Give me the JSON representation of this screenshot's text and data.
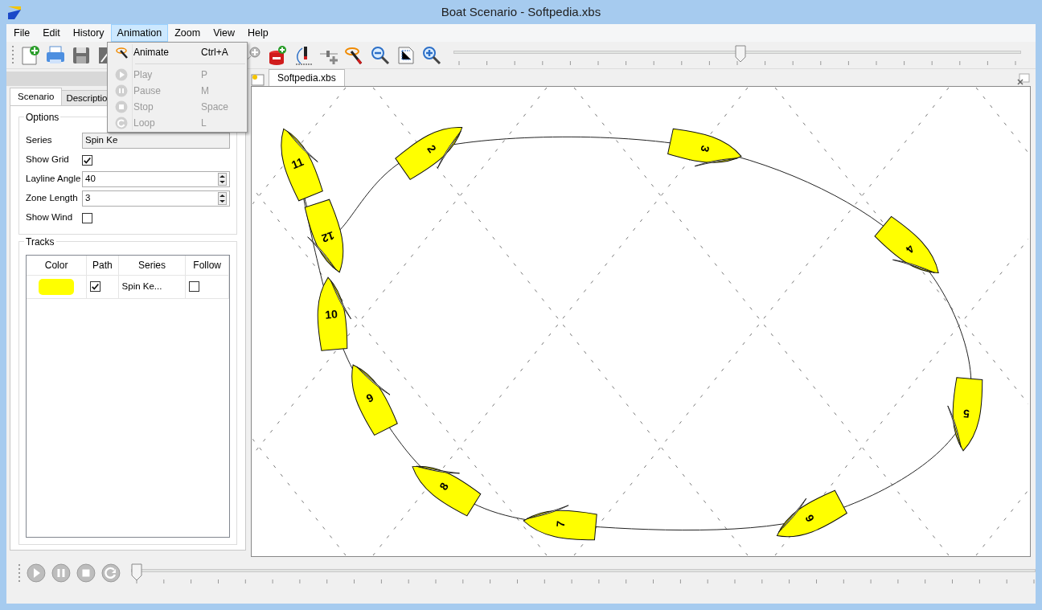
{
  "window": {
    "title": "Boat Scenario - Softpedia.xbs"
  },
  "menu_bar": [
    {
      "label": "File",
      "selected": false
    },
    {
      "label": "Edit",
      "selected": false
    },
    {
      "label": "History",
      "selected": false
    },
    {
      "label": "Animation",
      "selected": true
    },
    {
      "label": "Zoom",
      "selected": false
    },
    {
      "label": "View",
      "selected": false
    },
    {
      "label": "Help",
      "selected": false
    }
  ],
  "open_menu": {
    "items": [
      {
        "kind": "animate",
        "label": "Animate",
        "shortcut": "Ctrl+A",
        "disabled": false
      },
      {
        "kind": "separator"
      },
      {
        "kind": "play",
        "label": "Play",
        "shortcut": "P",
        "disabled": true
      },
      {
        "kind": "pause",
        "label": "Pause",
        "shortcut": "M",
        "disabled": true
      },
      {
        "kind": "stop",
        "label": "Stop",
        "shortcut": "Space",
        "disabled": true
      },
      {
        "kind": "loop",
        "label": "Loop",
        "shortcut": "L",
        "disabled": true
      }
    ]
  },
  "toolbar": {
    "time_slider": {
      "level": 0.506
    }
  },
  "side_panel": {
    "tabs": [
      {
        "label": "Scenario",
        "selected": true
      },
      {
        "label": "Descriptio",
        "selected": false
      }
    ],
    "options": {
      "title": "Options",
      "fields": [
        {
          "kind": "text",
          "label": "Series",
          "value": "Spin Ke"
        },
        {
          "kind": "checkbox",
          "label": "Show Grid",
          "checked": true
        },
        {
          "kind": "spin",
          "label": "Layline Angle",
          "value": "40"
        },
        {
          "kind": "spin",
          "label": "Zone Length",
          "value": "3"
        },
        {
          "kind": "checkbox",
          "label": "Show Wind",
          "checked": false
        }
      ]
    },
    "tracks": {
      "title": "Tracks",
      "columns": [
        "Color",
        "Path",
        "Series",
        "Follow"
      ],
      "rows": [
        {
          "color": "#ffff00",
          "path": true,
          "series": "Spin Ke...",
          "follow": false
        }
      ]
    }
  },
  "document_tabs": [
    {
      "label": "Softpedia.xbs",
      "selected": true
    }
  ],
  "canvas": {
    "boats": [
      {
        "number": "2"
      },
      {
        "number": "3"
      },
      {
        "number": "4"
      },
      {
        "number": "5"
      },
      {
        "number": "6"
      },
      {
        "number": "7"
      },
      {
        "number": "8"
      },
      {
        "number": "9"
      },
      {
        "number": "10"
      },
      {
        "number": "11"
      },
      {
        "number": "12"
      }
    ]
  },
  "playback": {
    "slider": {
      "level": 0
    }
  }
}
